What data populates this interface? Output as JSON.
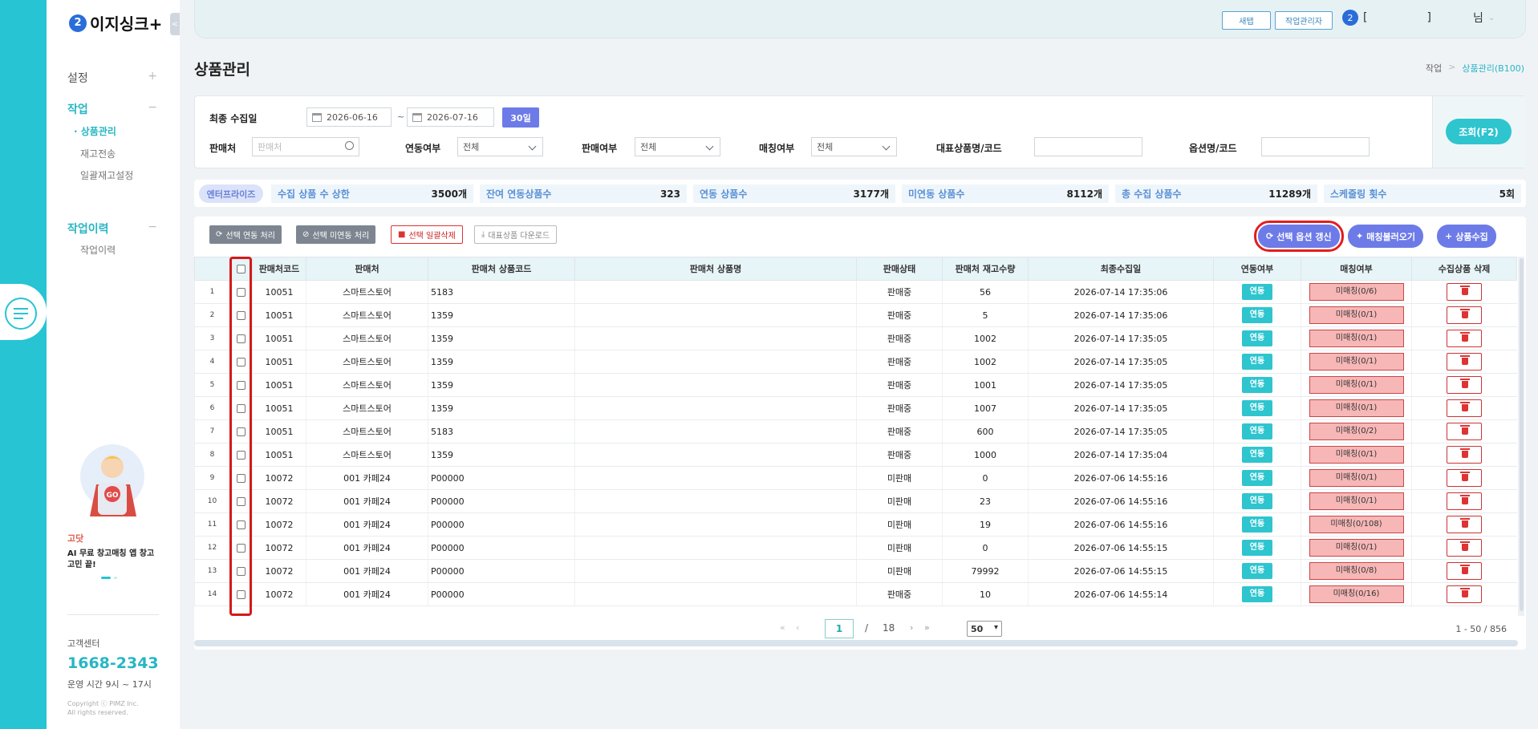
{
  "sidebar": {
    "logo": "이지싱크+",
    "logo_mark": "2",
    "collapse": "<",
    "sections": [
      {
        "label": "설정",
        "toggle": "+"
      },
      {
        "label": "작업",
        "toggle": "−"
      },
      {
        "label": "작업이력",
        "toggle": "−"
      }
    ],
    "work_items": [
      "· 상품관리",
      "재고전송",
      "일괄재고설정"
    ],
    "history_items": [
      "작업이력"
    ],
    "promo": {
      "brand": "고닷",
      "text": "AI 무료 창고매칭 앱 창고 고민 끝!",
      "badge": "GO"
    },
    "cs": {
      "label": "고객센터",
      "phone": "1668-2343",
      "hours": "운영 시간 9시 ~ 17시",
      "copyright": "Copyright ⓒ PIMZ Inc.",
      "rights": "All rights reserved."
    }
  },
  "topbar": {
    "new_tab": "새탭",
    "task_manager": "작업관리자",
    "user_icon": "2",
    "user_open": "[",
    "user_close": "]",
    "user_suffix": "님"
  },
  "page": {
    "title": "상품관리",
    "breadcrumb": [
      "작업",
      ">",
      "상품관리(B100)"
    ]
  },
  "filters": {
    "last_collect_label": "최종 수집일",
    "date_from": "2026-06-16",
    "date_sep": "~",
    "date_to": "2026-07-16",
    "range_btn": "30일",
    "seller_label": "판매처",
    "seller_placeholder": "판매처",
    "link_label": "연동여부",
    "link_value": "전체",
    "sale_label": "판매여부",
    "sale_value": "전체",
    "match_label": "매칭여부",
    "match_value": "전체",
    "rep_label": "대표상품명/코드",
    "option_label": "옵션명/코드",
    "search_btn": "조회(F2)"
  },
  "stats": {
    "tier": "엔터프라이즈",
    "items": [
      {
        "label": "수집 상품 수 상한",
        "value": "3500개"
      },
      {
        "label": "잔여 연동상품수",
        "value": "323"
      },
      {
        "label": "연동 상품수",
        "value": "3177개"
      },
      {
        "label": "미연동 상품수",
        "value": "8112개"
      },
      {
        "label": "총 수집 상품수",
        "value": "11289개"
      },
      {
        "label": "스케줄링 횟수",
        "value": "5회"
      }
    ]
  },
  "actions": {
    "link_sel": "선택 연동 처리",
    "unlink_sel": "선택 미연동 처리",
    "delete_sel": "선택 일괄삭제",
    "download": "대표상품 다운로드",
    "refresh_option": "선택 옵션 갱신",
    "load_match": "매칭불러오기",
    "collect": "상품수집"
  },
  "table": {
    "headers": [
      "",
      "",
      "판매처코드",
      "판매처",
      "판매처 상품코드",
      "판매처 상품명",
      "판매상태",
      "판매처 재고수량",
      "최종수집일",
      "연동여부",
      "매칭여부",
      "수집상품 삭제"
    ],
    "link_label": "연동",
    "rows": [
      {
        "n": "1",
        "code": "10051",
        "seller": "스마트스토어",
        "pcode": "5183",
        "status": "판매중",
        "qty": "56",
        "date": "2026-07-14 17:35:06",
        "match": "미매칭(0/6)"
      },
      {
        "n": "2",
        "code": "10051",
        "seller": "스마트스토어",
        "pcode": "1359",
        "status": "판매중",
        "qty": "5",
        "date": "2026-07-14 17:35:06",
        "match": "미매칭(0/1)"
      },
      {
        "n": "3",
        "code": "10051",
        "seller": "스마트스토어",
        "pcode": "1359",
        "status": "판매중",
        "qty": "1002",
        "date": "2026-07-14 17:35:05",
        "match": "미매칭(0/1)"
      },
      {
        "n": "4",
        "code": "10051",
        "seller": "스마트스토어",
        "pcode": "1359",
        "status": "판매중",
        "qty": "1002",
        "date": "2026-07-14 17:35:05",
        "match": "미매칭(0/1)"
      },
      {
        "n": "5",
        "code": "10051",
        "seller": "스마트스토어",
        "pcode": "1359",
        "status": "판매중",
        "qty": "1001",
        "date": "2026-07-14 17:35:05",
        "match": "미매칭(0/1)"
      },
      {
        "n": "6",
        "code": "10051",
        "seller": "스마트스토어",
        "pcode": "1359",
        "status": "판매중",
        "qty": "1007",
        "date": "2026-07-14 17:35:05",
        "match": "미매칭(0/1)"
      },
      {
        "n": "7",
        "code": "10051",
        "seller": "스마트스토어",
        "pcode": "5183",
        "status": "판매중",
        "qty": "600",
        "date": "2026-07-14 17:35:05",
        "match": "미매칭(0/2)"
      },
      {
        "n": "8",
        "code": "10051",
        "seller": "스마트스토어",
        "pcode": "1359",
        "status": "판매중",
        "qty": "1000",
        "date": "2026-07-14 17:35:04",
        "match": "미매칭(0/1)"
      },
      {
        "n": "9",
        "code": "10072",
        "seller": "001 카페24",
        "pcode": "P00000",
        "status": "미판매",
        "qty": "0",
        "date": "2026-07-06 14:55:16",
        "match": "미매칭(0/1)"
      },
      {
        "n": "10",
        "code": "10072",
        "seller": "001 카페24",
        "pcode": "P00000",
        "status": "미판매",
        "qty": "23",
        "date": "2026-07-06 14:55:16",
        "match": "미매칭(0/1)"
      },
      {
        "n": "11",
        "code": "10072",
        "seller": "001 카페24",
        "pcode": "P00000",
        "status": "미판매",
        "qty": "19",
        "date": "2026-07-06 14:55:16",
        "match": "미매칭(0/108)"
      },
      {
        "n": "12",
        "code": "10072",
        "seller": "001 카페24",
        "pcode": "P00000",
        "status": "미판매",
        "qty": "0",
        "date": "2026-07-06 14:55:15",
        "match": "미매칭(0/1)"
      },
      {
        "n": "13",
        "code": "10072",
        "seller": "001 카페24",
        "pcode": "P00000",
        "status": "미판매",
        "qty": "79992",
        "date": "2026-07-06 14:55:15",
        "match": "미매칭(0/8)"
      },
      {
        "n": "14",
        "code": "10072",
        "seller": "001 카페24",
        "pcode": "P00000",
        "status": "판매중",
        "qty": "10",
        "date": "2026-07-06 14:55:14",
        "match": "미매칭(0/16)"
      }
    ]
  },
  "pager": {
    "current": "1",
    "sep": "/",
    "total": "18",
    "page_size": "50",
    "range": "1 - 50 / 856",
    "first": "«",
    "prev": "‹",
    "next": "›",
    "last": "»"
  },
  "colors": {
    "accent": "#27c4d3",
    "primary": "#6d7be8",
    "highlight": "#e21e1e"
  },
  "icons": [
    "menu-icon",
    "calendar-icon",
    "search-icon",
    "refresh-icon",
    "ban-icon",
    "trash-icon",
    "download-icon",
    "wand-icon",
    "plus-icon"
  ]
}
